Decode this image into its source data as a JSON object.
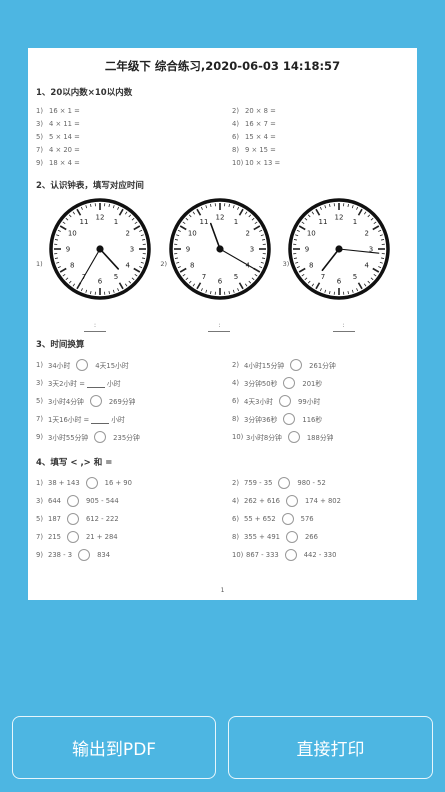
{
  "title": "二年级下 综合练习,2020-06-03 14:18:57",
  "sections": {
    "s1": "1、20以内数×10以内数",
    "s2": "2、认识钟表，填写对应时间",
    "s3": "3、时间换算",
    "s4": "4、填写 < ,> 和 ="
  },
  "q1": [
    [
      "1)",
      "16 × 1 ="
    ],
    [
      "2)",
      "20 × 8 ="
    ],
    [
      "3)",
      "4 × 11 ="
    ],
    [
      "4)",
      "16 × 7 ="
    ],
    [
      "5)",
      "5 × 14 ="
    ],
    [
      "6)",
      "15 × 4 ="
    ],
    [
      "7)",
      "4 × 20 ="
    ],
    [
      "8)",
      "9 × 15 ="
    ],
    [
      "9)",
      "18 × 4 ="
    ],
    [
      "10)",
      "10 × 13 ="
    ]
  ],
  "clocks": [
    {
      "label": "1)",
      "hour": 4,
      "minute": 35
    },
    {
      "label": "2)",
      "hour": 11,
      "minute": 20
    },
    {
      "label": "3)",
      "hour": 7,
      "minute": 16
    }
  ],
  "clock_answer_sep": ":",
  "q3": [
    {
      "n": "1)",
      "a": "34小时",
      "b": "4天15小时",
      "mode": "circle"
    },
    {
      "n": "2)",
      "a": "4小时15分钟",
      "b": "261分钟",
      "mode": "circle"
    },
    {
      "n": "3)",
      "a": "3天2小时 =",
      "b": "小时",
      "mode": "blank"
    },
    {
      "n": "4)",
      "a": "3分钟50秒",
      "b": "201秒",
      "mode": "circle"
    },
    {
      "n": "5)",
      "a": "3小时4分钟",
      "b": "269分钟",
      "mode": "circle"
    },
    {
      "n": "6)",
      "a": "4天3小时",
      "b": "99小时",
      "mode": "circle"
    },
    {
      "n": "7)",
      "a": "1天16小时 =",
      "b": "小时",
      "mode": "blank"
    },
    {
      "n": "8)",
      "a": "3分钟36秒",
      "b": "116秒",
      "mode": "circle"
    },
    {
      "n": "9)",
      "a": "3小时55分钟",
      "b": "235分钟",
      "mode": "circle"
    },
    {
      "n": "10)",
      "a": "3小时8分钟",
      "b": "188分钟",
      "mode": "circle"
    }
  ],
  "q4": [
    [
      "1)",
      "38 + 143",
      "16 + 90"
    ],
    [
      "2)",
      "759 - 35",
      "980 - 52"
    ],
    [
      "3)",
      "644",
      "905 - 544"
    ],
    [
      "4)",
      "262 + 616",
      "174 + 802"
    ],
    [
      "5)",
      "187",
      "612 - 222"
    ],
    [
      "6)",
      "55 + 652",
      "576"
    ],
    [
      "7)",
      "215",
      "21 + 284"
    ],
    [
      "8)",
      "355 + 491",
      "266"
    ],
    [
      "9)",
      "238 - 3",
      "834"
    ],
    [
      "10)",
      "867 - 333",
      "442 - 330"
    ]
  ],
  "page_number": "1",
  "buttons": {
    "pdf": "输出到PDF",
    "print": "直接打印"
  }
}
